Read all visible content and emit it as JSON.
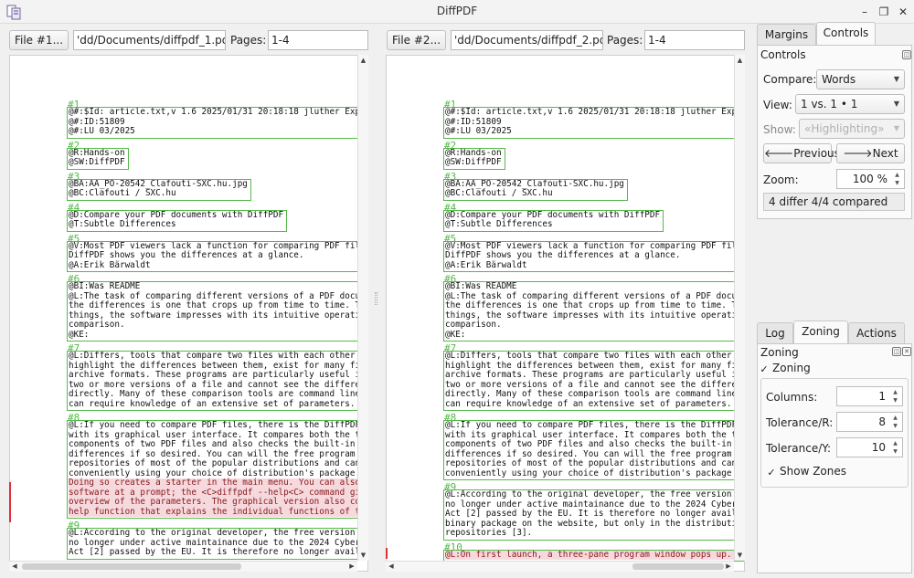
{
  "window": {
    "title": "DiffPDF",
    "min_icon": "minimize-icon",
    "max_icon": "restore-icon",
    "close_icon": "close-icon"
  },
  "left": {
    "file_button": "File #1...",
    "file_path": "'dd/Documents/diffpdf_1.pdf",
    "pages_label": "Pages:",
    "pages_value": "1-4",
    "zones": [
      {
        "num": "#1",
        "lines": [
          "@#:$Id: article.txt,v 1.6 2025/01/31 20:18:18 jluther Exp $",
          "@#:ID:51809",
          "@#:LU 03/2025"
        ]
      },
      {
        "num": "#2",
        "lines": [
          "@R:Hands-on",
          "@SW:DiffPDF"
        ]
      },
      {
        "num": "#3",
        "lines": [
          "@BA:AA_PO-20542_Clafouti-SXC.hu.jpg",
          "@BC:Clafouti / SXC.hu"
        ]
      },
      {
        "num": "#4",
        "lines": [
          "@D:Compare your PDF documents with DiffPDF",
          "@T:Subtle Differences"
        ]
      },
      {
        "num": "#5",
        "lines": [
          "@V:Most PDF viewers lack a function for comparing PDF files,",
          "DiffPDF shows you the differences at a glance.",
          "@A:Erik Bärwaldt"
        ]
      },
      {
        "num": "#6",
        "lines": [
          "@BI:Was README",
          "@L:The task of comparing different versions of a PDF documen",
          "the differences is one that crops up from time to time. Than",
          "things, the software impresses with its intuitive operation",
          "comparison.",
          "@KE:"
        ]
      },
      {
        "num": "#7",
        "lines": [
          "@L:Differs, tools that compare two files with each other and",
          "highlight the differences between them, exist for many file",
          "archive formats. These programs are particularly useful if y",
          "two or more versions of a file and cannot see the difference",
          "directly. Many of these comparison tools are command line-ba",
          "can require knowledge of an extensive set of parameters."
        ]
      },
      {
        "num": "#8",
        "lines": [
          "@L:If you need to compare PDF files, there is the DiffPDF [1",
          "with its graphical user interface. It compares both the text",
          "components of two PDF files and also checks the built-in ima",
          "differences if so desired. You can will the free program in",
          "repositories of most of the popular distributions and can in",
          "conveniently using your choice of distribution's package man"
        ],
        "highlight": [
          "Doing so creates a starter in the main menu. You can also ru",
          "software at a prompt; the <C>diffpdf --help<C> command gives",
          "overview of the parameters. The graphical version also comes",
          "help function that explains the individual functions of the"
        ]
      },
      {
        "num": "#9",
        "lines": [
          "@L:According to the original developer, the free version of",
          "no longer under active maintainance due to the 2024 Cyber Re",
          "Act [2] passed by the EU. It is therefore no longer availab"
        ]
      }
    ]
  },
  "right": {
    "file_button": "File #2...",
    "file_path": "'dd/Documents/diffpdf_2.pdf",
    "pages_label": "Pages:",
    "pages_value": "1-4",
    "zones": [
      {
        "num": "#1",
        "lines": [
          "@#:$Id: article.txt,v 1.6 2025/01/31 20:18:18 jluther Exp $",
          "@#:ID:51809",
          "@#:LU 03/2025"
        ]
      },
      {
        "num": "#2",
        "lines": [
          "@R:Hands-on",
          "@SW:DiffPDF"
        ]
      },
      {
        "num": "#3",
        "lines": [
          "@BA:AA_PO-20542_Clafouti-SXC.hu.jpg",
          "@BC:Clafouti / SXC.hu"
        ]
      },
      {
        "num": "#4",
        "lines": [
          "@D:Compare your PDF documents with DiffPDF",
          "@T:Subtle Differences"
        ]
      },
      {
        "num": "#5",
        "lines": [
          "@V:Most PDF viewers lack a function for comparing PDF files,",
          "DiffPDF shows you the differences at a glance.",
          "@A:Erik Bärwaldt"
        ]
      },
      {
        "num": "#6",
        "lines": [
          "@BI:Was README",
          "@L:The task of comparing different versions of a PDF documen",
          "the differences is one that crops up from time to time. Than",
          "things, the software impresses with its intuitive operation",
          "comparison.",
          "@KE:"
        ]
      },
      {
        "num": "#7",
        "lines": [
          "@L:Differs, tools that compare two files with each other and",
          "highlight the differences between them, exist for many file",
          "archive formats. These programs are particularly useful if y",
          "two or more versions of a file and cannot see the difference",
          "directly. Many of these comparison tools are command line-ba",
          "can require knowledge of an extensive set of parameters."
        ]
      },
      {
        "num": "#8",
        "lines": [
          "@L:If you need to compare PDF files, there is the DiffPDF [1",
          "with its graphical user interface. It compares both the text",
          "components of two PDF files and also checks the built-in ima",
          "differences if so desired. You can will the free program in",
          "repositories of most of the popular distributions and can in",
          "conveniently using your choice of distribution's package man"
        ]
      },
      {
        "num": "#9",
        "lines": [
          "@L:According to the original developer, the free version of",
          "no longer under active maintainance due to the 2024 Cyber Re",
          "Act [2] passed by the EU. It is therefore no longer availabl",
          "binary package on the website, but only in the distribution",
          "repositories [3]."
        ]
      },
      {
        "num": "#10",
        "lines": [],
        "highlight": [
          "@L:On first launch, a three-pane program window pops up. Whe"
        ]
      }
    ]
  },
  "controls": {
    "tabs": [
      "Margins",
      "Controls"
    ],
    "active_tab": "Controls",
    "panel_title": "Controls",
    "compare_label": "Compare:",
    "compare_value": "Words",
    "view_label": "View:",
    "view_value": "1 vs. 1 • 1",
    "show_label": "Show:",
    "show_value": "«Highlighting»",
    "previous_label": "Previous",
    "next_label": "Next",
    "zoom_label": "Zoom:",
    "zoom_value": "100 %",
    "status": "4 differ 4/4 compared"
  },
  "zoning": {
    "tabs": [
      "Log",
      "Zoning",
      "Actions"
    ],
    "active_tab": "Zoning",
    "panel_title": "Zoning",
    "zoning_check": "Zoning",
    "zoning_checked": true,
    "columns_label": "Columns:",
    "columns_value": "1",
    "tol_r_label": "Tolerance/R:",
    "tol_r_value": "8",
    "tol_y_label": "Tolerance/Y:",
    "tol_y_value": "10",
    "show_zones_label": "Show Zones",
    "show_zones_checked": true
  },
  "colors": {
    "zone": "#55b94a",
    "highlight_bg": "#f5d9dc",
    "highlight_fg": "#8a1a22",
    "marker": "#e0303a"
  }
}
